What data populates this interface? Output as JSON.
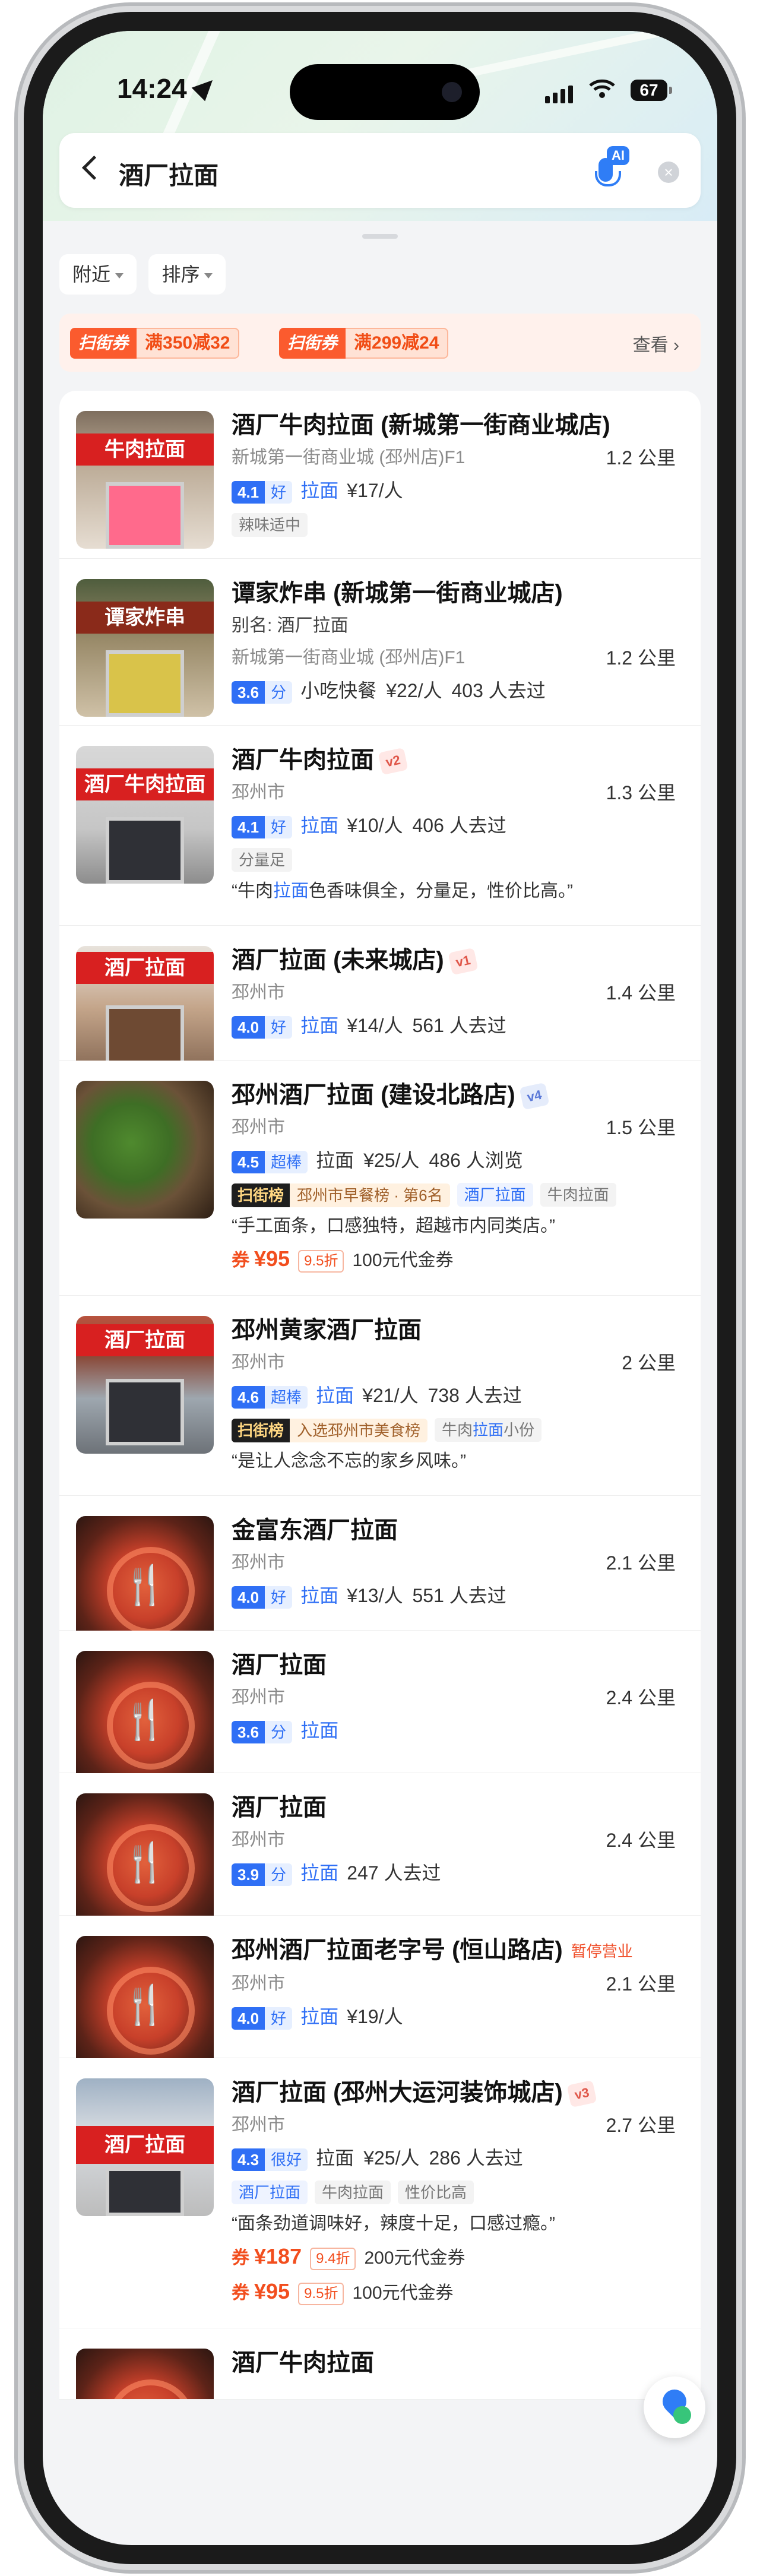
{
  "status": {
    "time": "14:24",
    "battery": "67"
  },
  "search": {
    "query": "酒厂拉面",
    "ai_label": "AI"
  },
  "filters": [
    "附近",
    "排序"
  ],
  "coupons": [
    {
      "tag": "扫街券",
      "text": "满350减32"
    },
    {
      "tag": "扫街券",
      "text": "满299减24"
    }
  ],
  "coupon_more": "查看 ›",
  "listings": [
    {
      "name": "酒厂牛肉拉面 (新城第一街商业城店)",
      "address": "新城第一街商业城 (邳州店)F1",
      "distance": "1.2 公里",
      "rating": "4.1",
      "rating_word": "好",
      "category": "拉面",
      "price": "¥17/人",
      "tags": [
        "辣味适中"
      ]
    },
    {
      "name": "谭家炸串 (新城第一街商业城店)",
      "alias": "别名: 酒厂拉面",
      "address": "新城第一街商业城 (邳州店)F1",
      "distance": "1.2 公里",
      "rating": "3.6",
      "rating_word": "分",
      "category": "小吃快餐",
      "price": "¥22/人",
      "visits": "403 人去过"
    },
    {
      "name": "酒厂牛肉拉面",
      "badge": "v2",
      "address": "邳州市",
      "distance": "1.3 公里",
      "rating": "4.1",
      "rating_word": "好",
      "category": "拉面",
      "price": "¥10/人",
      "visits": "406 人去过",
      "tags": [
        "分量足"
      ],
      "quote_pre": "“牛肉",
      "quote_hl": "拉面",
      "quote_post": "色香味俱全，分量足，性价比高。”"
    },
    {
      "name": "酒厂拉面 (未来城店)",
      "badge": "v1",
      "address": "邳州市",
      "distance": "1.4 公里",
      "rating": "4.0",
      "rating_word": "好",
      "category": "拉面",
      "price": "¥14/人",
      "visits": "561 人去过"
    },
    {
      "name": "邳州酒厂拉面 (建设北路店)",
      "badge": "v4",
      "address": "邳州市",
      "distance": "1.5 公里",
      "rating": "4.5",
      "rating_word": "超棒",
      "category": "拉面",
      "price": "¥25/人",
      "visits": "486 人浏览",
      "rank_key": "扫街榜",
      "rank_val": "邳州市早餐榜 · 第6名",
      "tags_blue": [
        "酒厂拉面"
      ],
      "tags": [
        "牛肉拉面"
      ],
      "quote": "“手工面条，口感独特，超越市内同类店。”",
      "deal": {
        "label": "券",
        "price": "¥95",
        "discount": "9.5折",
        "desc": "100元代金券"
      }
    },
    {
      "name": "邳州黄家酒厂拉面",
      "address": "邳州市",
      "distance": "2 公里",
      "rating": "4.6",
      "rating_word": "超棒",
      "category": "拉面",
      "price": "¥21/人",
      "visits": "738 人去过",
      "rank_key": "扫街榜",
      "rank_val": "入选邳州市美食榜",
      "tag_pre": "牛肉",
      "tag_hl": "拉面",
      "tag_post": "小份",
      "quote": "“是让人念念不忘的家乡风味。”"
    },
    {
      "name": "金富东酒厂拉面",
      "address": "邳州市",
      "distance": "2.1 公里",
      "rating": "4.0",
      "rating_word": "好",
      "category": "拉面",
      "price": "¥13/人",
      "visits": "551 人去过"
    },
    {
      "name": "酒厂拉面",
      "address": "邳州市",
      "distance": "2.4 公里",
      "rating": "3.6",
      "rating_word": "分",
      "category": "拉面"
    },
    {
      "name": "酒厂拉面",
      "address": "邳州市",
      "distance": "2.4 公里",
      "rating": "3.9",
      "rating_word": "分",
      "category": "拉面",
      "visits": "247 人去过"
    },
    {
      "name": "邳州酒厂拉面老字号 (恒山路店)",
      "closed": "暂停营业",
      "address": "邳州市",
      "distance": "2.1 公里",
      "rating": "4.0",
      "rating_word": "好",
      "category": "拉面",
      "price": "¥19/人"
    },
    {
      "name": "酒厂拉面 (邳州大运河装饰城店)",
      "badge": "v3",
      "address": "邳州市",
      "distance": "2.7 公里",
      "rating": "4.3",
      "rating_word": "很好",
      "category": "拉面",
      "price": "¥25/人",
      "visits": "286 人去过",
      "tags_blue": [
        "酒厂拉面"
      ],
      "tags": [
        "牛肉拉面",
        "性价比高"
      ],
      "quote": "“面条劲道调味好，辣度十足，口感过瘾。”",
      "deal": {
        "label": "券",
        "price": "¥187",
        "discount": "9.4折",
        "desc": "200元代金券"
      },
      "deal2": {
        "label": "券",
        "price": "¥95",
        "discount": "9.5折",
        "desc": "100元代金券"
      }
    },
    {
      "name": "酒厂牛肉拉面"
    }
  ],
  "thumb_signs": [
    "牛肉拉面",
    "谭家炸串",
    "酒厂牛肉拉面",
    "酒厂拉面",
    "酒厂拉面",
    "酒厂拉面"
  ],
  "colors": {
    "accent": "#2f6ff5",
    "coupon": "#fb5b2e",
    "price": "#f24e1e"
  }
}
